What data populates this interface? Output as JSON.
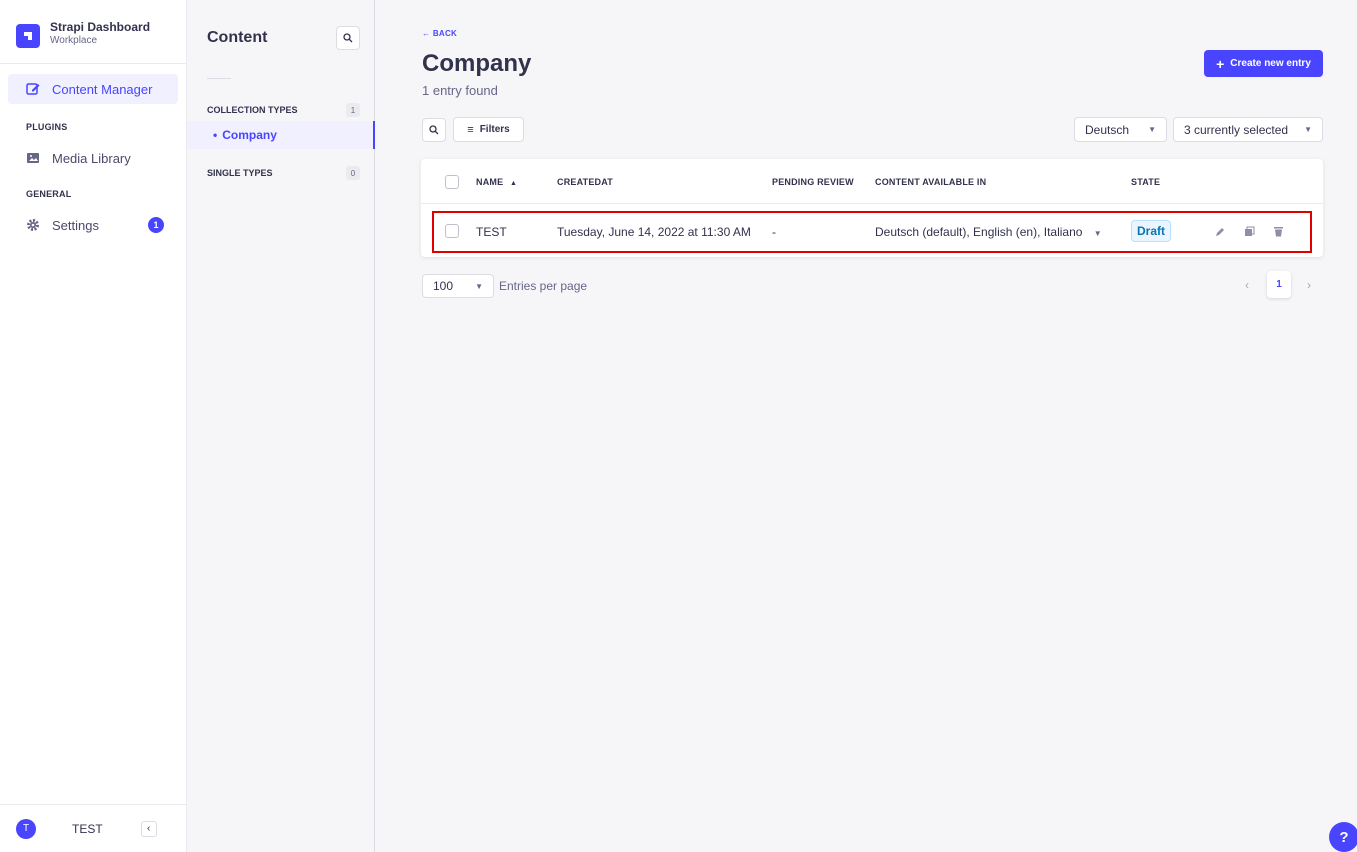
{
  "brand": {
    "title": "Strapi Dashboard",
    "subtitle": "Workplace"
  },
  "nav": {
    "content_manager": "Content Manager",
    "plugins_section": "PLUGINS",
    "media_library": "Media Library",
    "general_section": "GENERAL",
    "settings": "Settings",
    "settings_badge": "1"
  },
  "footer": {
    "avatar_initial": "T",
    "user_name": "TEST",
    "collapse_icon": "chevron-left-icon"
  },
  "subnav": {
    "title": "Content",
    "collection_types": {
      "label": "COLLECTION TYPES",
      "count": "1",
      "items": [
        "Company"
      ]
    },
    "single_types": {
      "label": "SINGLE TYPES",
      "count": "0"
    }
  },
  "header": {
    "back_label": "← BACK",
    "title": "Company",
    "subtitle": "1 entry found",
    "create_button": "Create new entry"
  },
  "toolbar": {
    "filters_label": "Filters",
    "locale_select": "Deutsch",
    "columns_select": "3 currently selected"
  },
  "table": {
    "headers": {
      "name": "NAME",
      "createdat": "CREATEDAT",
      "pending_review": "PENDING REVIEW",
      "content_available_in": "CONTENT AVAILABLE IN",
      "state": "STATE"
    },
    "rows": [
      {
        "name": "TEST",
        "createdat": "Tuesday, June 14, 2022 at 11:30 AM",
        "pending_review": "-",
        "content_available_in": "Deutsch (default), English (en), Italiano",
        "state": "Draft"
      }
    ]
  },
  "pagination": {
    "per_page": "100",
    "per_page_label": "Entries per page",
    "current_page": "1"
  },
  "help_label": "?",
  "colors": {
    "accent": "#4945ff",
    "highlight_box": "#e00000",
    "draft_badge": "#0c75af"
  }
}
